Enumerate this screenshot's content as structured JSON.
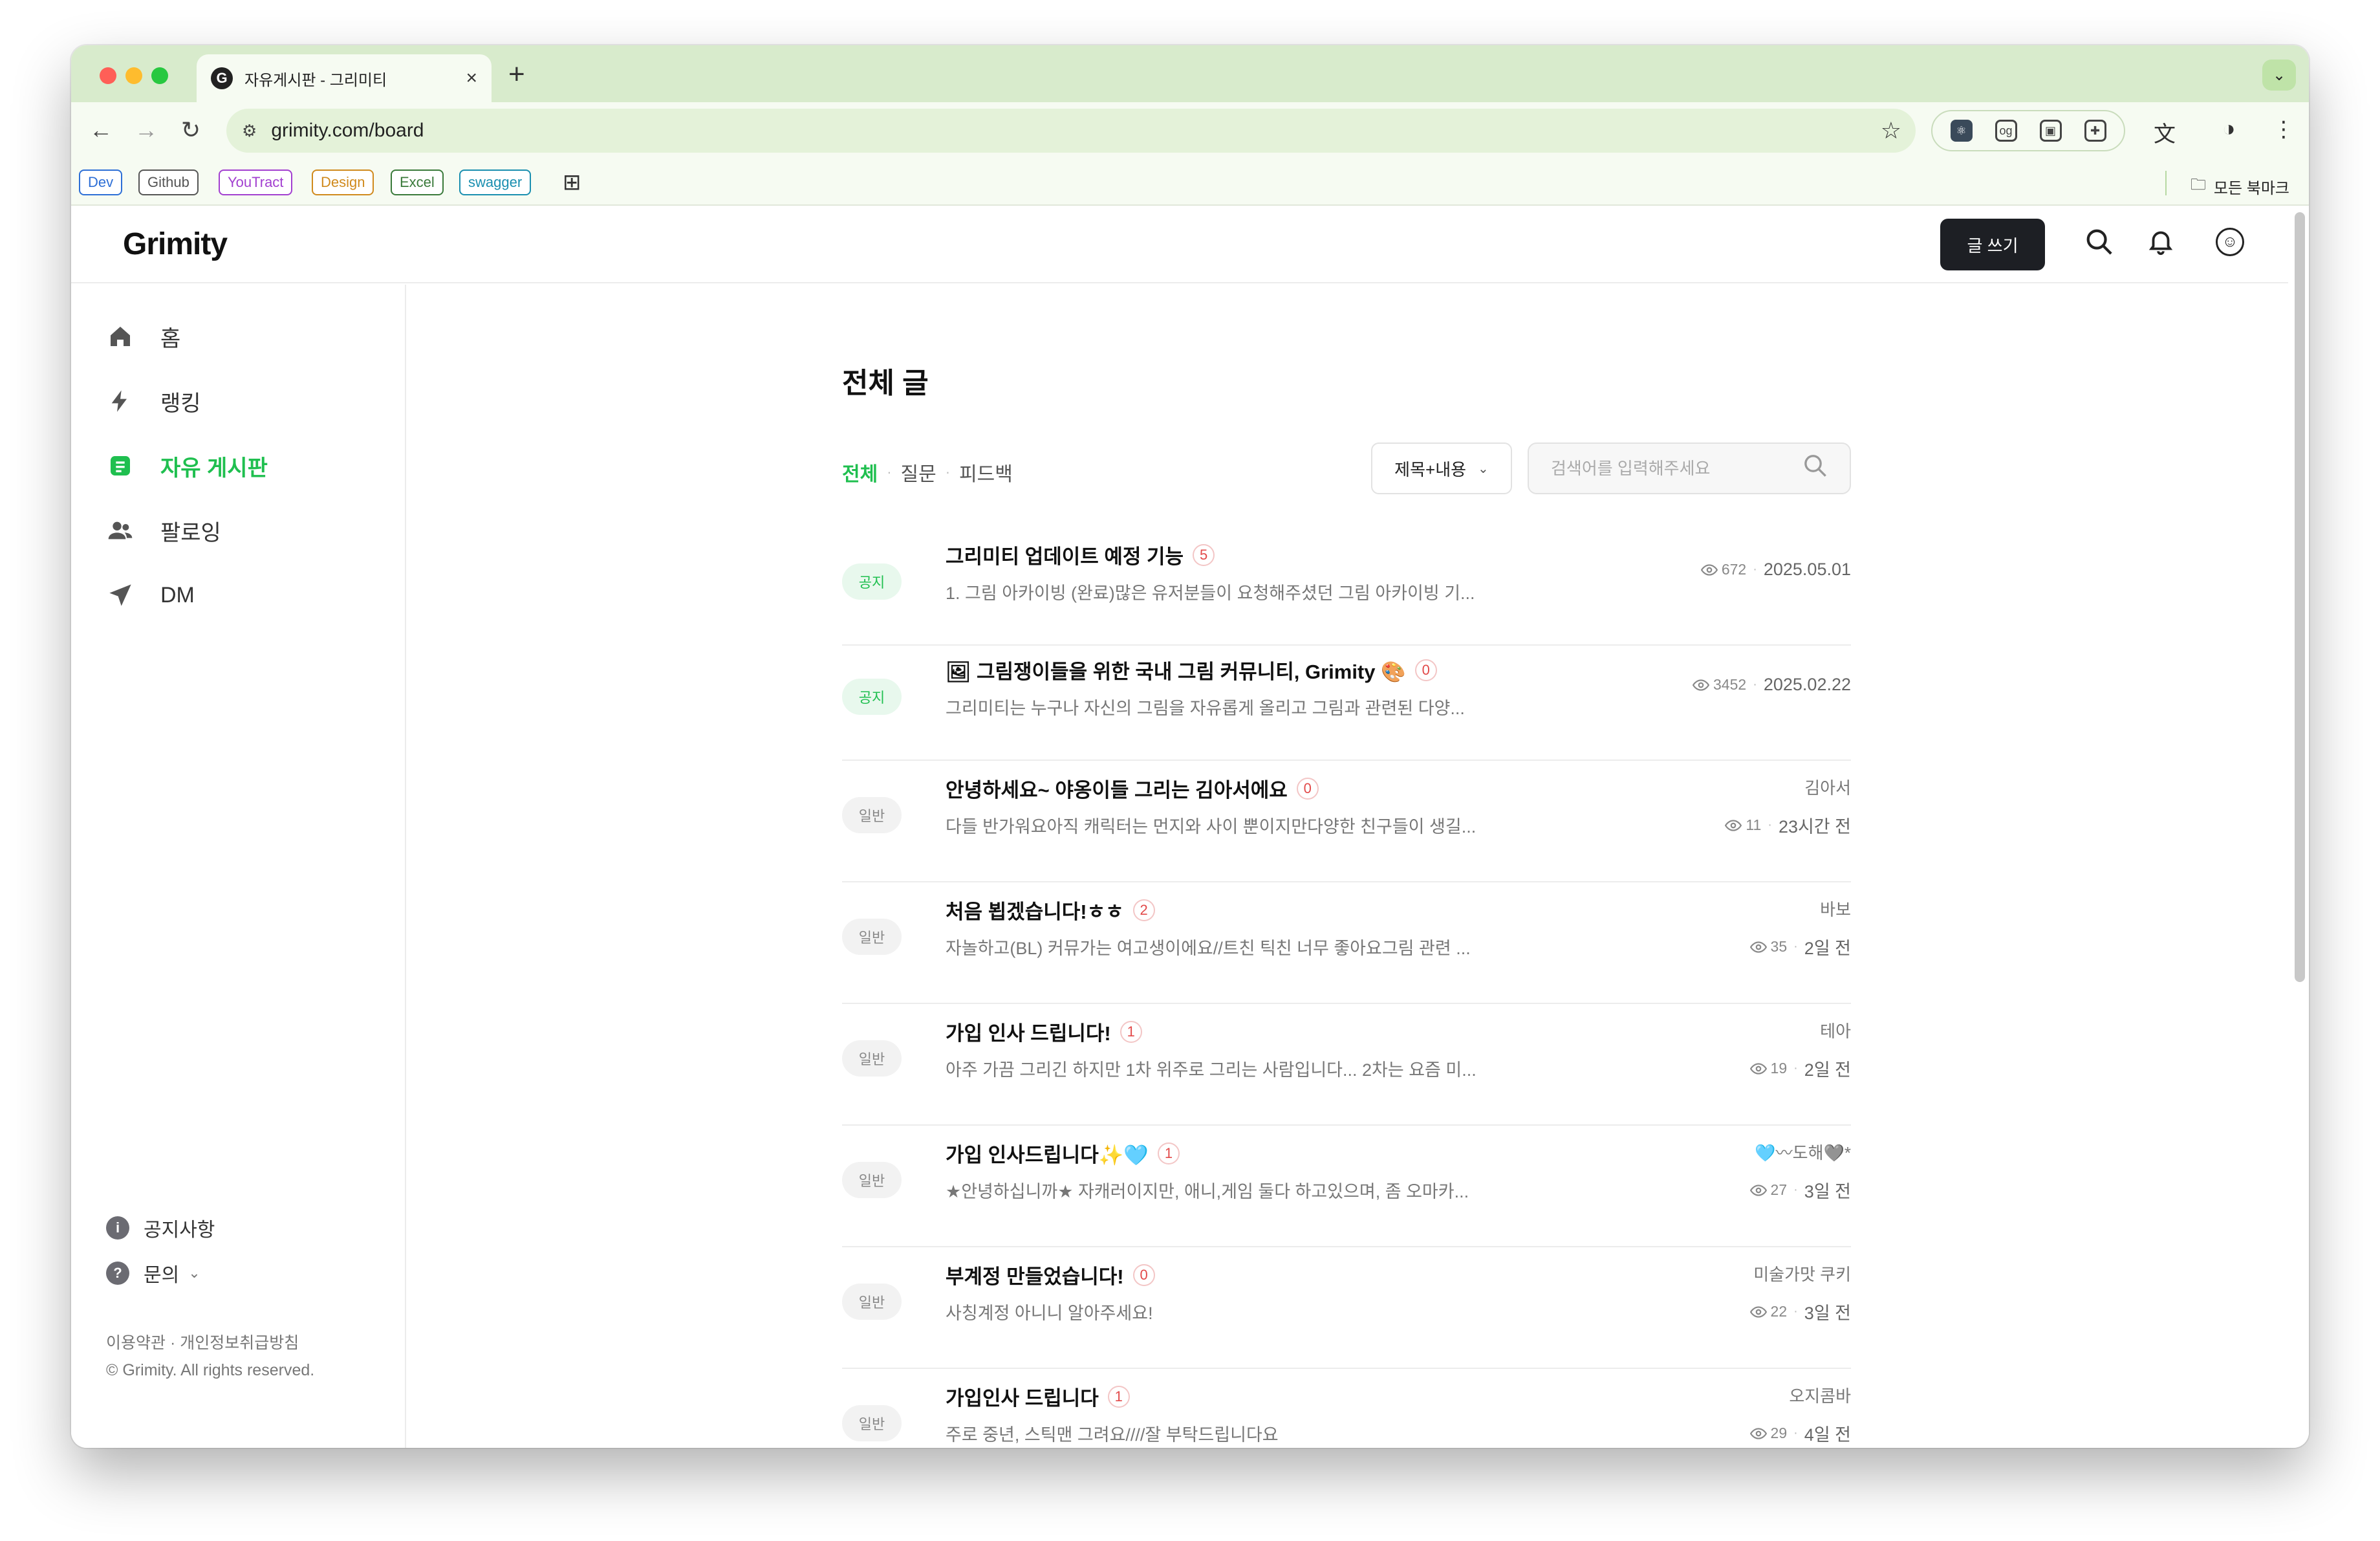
{
  "browser": {
    "tab_title": "자유게시판 - 그리미티",
    "tab_favicon": "G",
    "tab_close": "×",
    "new_tab": "+",
    "tab_menu": "⌄",
    "url": "grimity.com/board",
    "bookmarks": [
      {
        "label": "Dev",
        "color": "#2d6fd6"
      },
      {
        "label": "Github",
        "color": "#555555"
      },
      {
        "label": "YouTract",
        "color": "#a23fd0"
      },
      {
        "label": "Design",
        "color": "#d08a1d"
      },
      {
        "label": "Excel",
        "color": "#3a7a3a"
      },
      {
        "label": "swagger",
        "color": "#1a8fb0"
      }
    ],
    "all_bookmarks": "모든 북마크"
  },
  "header": {
    "logo": "Grimity",
    "write_button": "글 쓰기"
  },
  "sidebar": {
    "items": [
      {
        "label": "홈",
        "icon": "home-icon",
        "active": false
      },
      {
        "label": "랭킹",
        "icon": "lightning-icon",
        "active": false
      },
      {
        "label": "자유 게시판",
        "icon": "board-icon",
        "active": true
      },
      {
        "label": "팔로잉",
        "icon": "people-icon",
        "active": false
      },
      {
        "label": "DM",
        "icon": "send-icon",
        "active": false
      }
    ],
    "notice": "공지사항",
    "inquiry": "문의",
    "footer_links": "이용약관 · 개인정보취급방침",
    "copyright": "© Grimity. All rights reserved."
  },
  "main": {
    "title": "전체 글",
    "filters": [
      "전체",
      "질문",
      "피드백"
    ],
    "select_value": "제목+내용",
    "search_placeholder": "검색어를 입력해주세요",
    "posts": [
      {
        "badge": "공지",
        "type": "notice",
        "title": "그리미티 업데이트 예정 기능",
        "comments": "5",
        "excerpt": "1. 그림 아카이빙 (완료)많은 유저분들이 요청해주셨던 그림 아카이빙 기...",
        "author": "",
        "views": "672",
        "date": "2025.05.01"
      },
      {
        "badge": "공지",
        "type": "notice",
        "title": "🖼 그림쟁이들을 위한 국내 그림 커뮤니티, Grimity 🎨",
        "comments": "0",
        "excerpt": "그리미티는 누구나 자신의 그림을 자유롭게 올리고 그림과 관련된 다양...",
        "author": "",
        "views": "3452",
        "date": "2025.02.22"
      },
      {
        "badge": "일반",
        "type": "normal",
        "title": "안녕하세요~ 야옹이들 그리는 김아서에요",
        "comments": "0",
        "excerpt": "다들 반가워요아직 캐릭터는 먼지와 사이 뿐이지만다양한 친구들이 생길...",
        "author": "김아서",
        "views": "11",
        "date": "23시간 전"
      },
      {
        "badge": "일반",
        "type": "normal",
        "title": "처음 뵙겠습니다!ㅎㅎ",
        "comments": "2",
        "excerpt": "자놀하고(BL) 커뮤가는 여고생이에요//트친 틱친 너무 좋아요그림 관련 ...",
        "author": "바보",
        "views": "35",
        "date": "2일 전"
      },
      {
        "badge": "일반",
        "type": "normal",
        "title": "가입 인사 드립니다!",
        "comments": "1",
        "excerpt": "아주 가끔 그리긴 하지만 1차 위주로 그리는 사람입니다... 2차는 요즘 미...",
        "author": "테아",
        "views": "19",
        "date": "2일 전"
      },
      {
        "badge": "일반",
        "type": "normal",
        "title": "가입 인사드립니다✨🩵",
        "comments": "1",
        "excerpt": "★안녕하십니까★ 자캐러이지만, 애니,게임 둘다 하고있으며, 좀 오마카...",
        "author": "🩵〰도해🩶*",
        "views": "27",
        "date": "3일 전"
      },
      {
        "badge": "일반",
        "type": "normal",
        "title": "부계정 만들었습니다!",
        "comments": "0",
        "excerpt": "사칭계정 아니니 알아주세요!",
        "author": "미술가맛 쿠키",
        "views": "22",
        "date": "3일 전"
      },
      {
        "badge": "일반",
        "type": "normal",
        "title": "가입인사 드립니다",
        "comments": "1",
        "excerpt": "주로 중년, 스틱맨 그려요////잘 부탁드립니다요",
        "author": "오지콤바",
        "views": "29",
        "date": "4일 전"
      }
    ]
  }
}
